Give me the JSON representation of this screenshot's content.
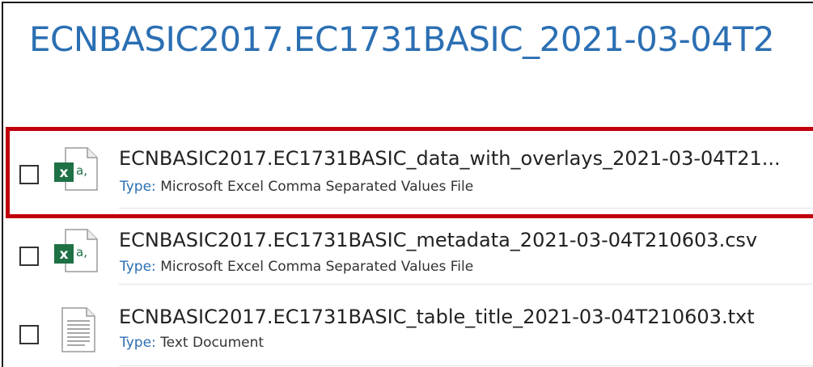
{
  "folder": {
    "title": "ECNBASIC2017.EC1731BASIC_2021-03-04T2"
  },
  "files": [
    {
      "name": "ECNBASIC2017.EC1731BASIC_data_with_overlays_2021-03-04T21...",
      "type_label": "Type:",
      "type_value": "Microsoft Excel Comma Separated Values File",
      "icon": "excel-csv-icon",
      "highlighted": true
    },
    {
      "name": "ECNBASIC2017.EC1731BASIC_metadata_2021-03-04T210603.csv",
      "type_label": "Type:",
      "type_value": "Microsoft Excel Comma Separated Values File",
      "icon": "excel-csv-icon"
    },
    {
      "name": "ECNBASIC2017.EC1731BASIC_table_title_2021-03-04T210603.txt",
      "type_label": "Type:",
      "type_value": "Text Document",
      "icon": "text-document-icon"
    }
  ],
  "colors": {
    "title": "#2b6fb3",
    "highlight": "#c0000c",
    "excel_green": "#1e7145"
  }
}
